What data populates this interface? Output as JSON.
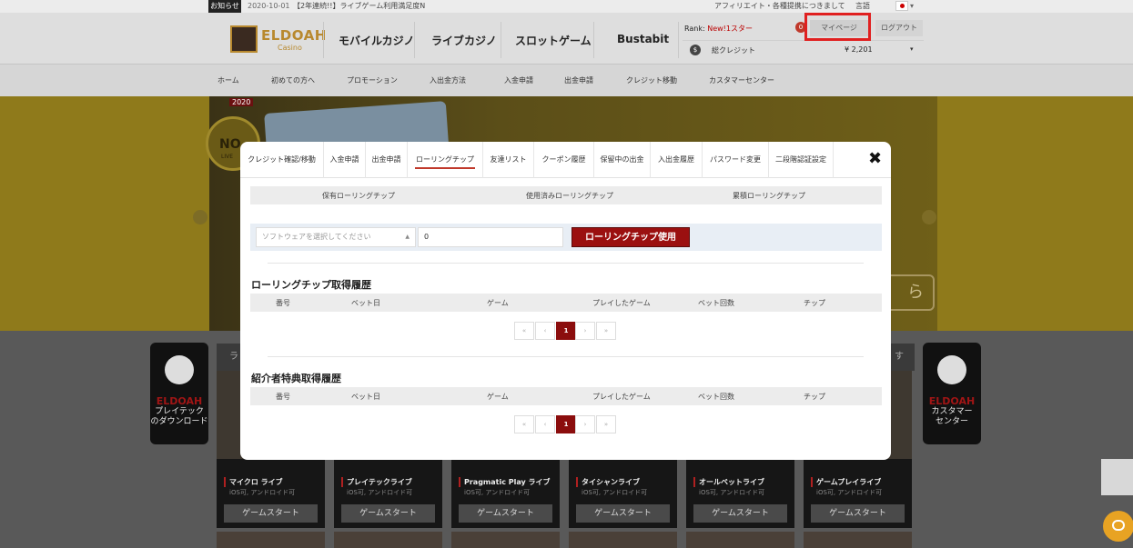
{
  "topbar": {
    "notice_tag": "お知らせ",
    "notice_date": "2020-10-01",
    "notice_text": "【2年連続!!】ライブゲーム利用満足度N",
    "affiliate_text": "アフィリエイト・各種提携につきまして",
    "lang_label": "言語",
    "lang_caret": "▾"
  },
  "header": {
    "logo_name": "ELDOAH",
    "logo_sub": "Casino",
    "nav": [
      "モバイルカジノ",
      "ライブカジノ",
      "スロットゲーム",
      "Bustabit"
    ],
    "rank_label": "Rank:",
    "rank_value": "New!1スター",
    "badge_count": "0",
    "mypage_label": "マイページ",
    "logout_label": "ログアウト",
    "credit_icon": "$",
    "credit_label": "総クレジット",
    "credit_value": "¥ 2,201",
    "credit_caret": "▾"
  },
  "subnav": [
    "ホーム",
    "初めての方へ",
    "プロモーション",
    "入出金方法",
    "入金申請",
    "出金申請",
    "クレジット移動",
    "カスタマーセンター"
  ],
  "hero": {
    "year": "2020",
    "seal_text": "NO",
    "seal_sub": "LIVE",
    "button_fragment": "ら"
  },
  "lower": {
    "left_card": {
      "brand": "ELDOAH",
      "desc": "プレイテック\nのダウンロード",
      "icon": "download-icon"
    },
    "right_card": {
      "brand": "ELDOAH",
      "desc": "カスタマー\nセンター",
      "icon": "support-agent-icon"
    },
    "tab_left_fragment": "ラ",
    "tab_right_fragment": "す",
    "games": [
      {
        "name": "マイクロ ライブ",
        "sub": "iOS可, アンドロイド可",
        "button": "ゲームスタート"
      },
      {
        "name": "プレイテックライブ",
        "sub": "iOS可, アンドロイド可",
        "button": "ゲームスタート"
      },
      {
        "name": "Pragmatic Play ライブ",
        "sub": "iOS可, アンドロイド可",
        "button": "ゲームスタート"
      },
      {
        "name": "タイシャンライブ",
        "sub": "iOS可, アンドロイド可",
        "button": "ゲームスタート"
      },
      {
        "name": "オールベットライブ",
        "sub": "iOS可, アンドロイド可",
        "button": "ゲームスタート"
      },
      {
        "name": "ゲームプレイライブ",
        "sub": "iOS可, アンドロイド可",
        "button": "ゲームスタート"
      }
    ]
  },
  "modal": {
    "tabs": [
      "クレジット確認/移動",
      "入金申請",
      "出金申請",
      "ローリングチップ",
      "友達リスト",
      "クーポン履歴",
      "保留中の出金",
      "入出金履歴",
      "パスワード変更",
      "二段階認証設定"
    ],
    "active_tab": "ローリングチップ",
    "close_icon": "✖",
    "chip_summary": [
      "保有ローリングチップ",
      "使用済みローリングチップ",
      "累積ローリングチップ"
    ],
    "software_placeholder": "ソフトウェアを選択してください",
    "select_caret": "▲",
    "amount_value": "0",
    "use_button": "ローリングチップ使用",
    "section1_title": "ローリングチップ取得履歴",
    "section2_title": "紹介者特典取得履歴",
    "columns": [
      "番号",
      "ベット日",
      "ゲーム",
      "プレイしたゲーム",
      "ベット回数",
      "チップ"
    ],
    "pager": {
      "first": "«",
      "prev": "‹",
      "current": "1",
      "next": "›",
      "last": "»"
    }
  }
}
